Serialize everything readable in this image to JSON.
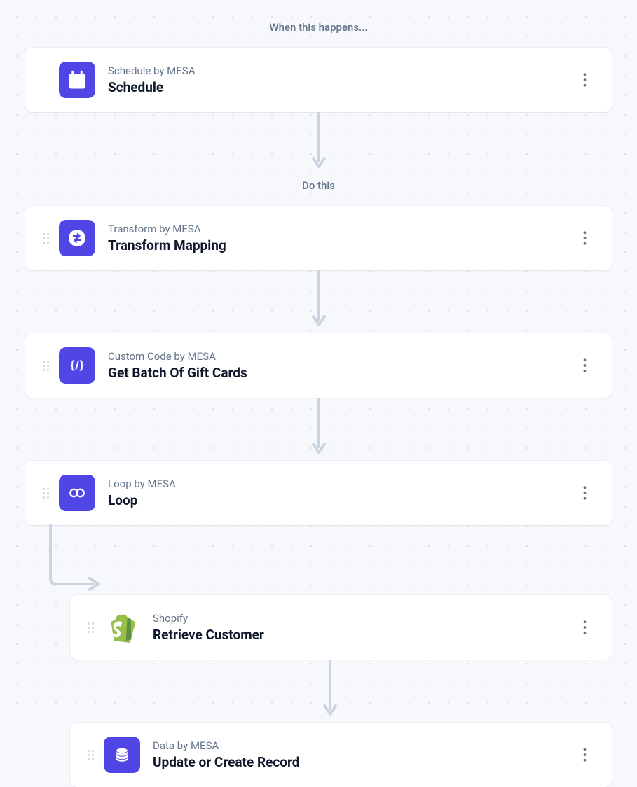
{
  "sections": {
    "trigger_label": "When this happens...",
    "action_label": "Do this"
  },
  "steps": [
    {
      "subtitle": "Schedule by MESA",
      "title": "Schedule"
    },
    {
      "subtitle": "Transform by MESA",
      "title": "Transform Mapping"
    },
    {
      "subtitle": "Custom Code by MESA",
      "title": "Get Batch Of Gift Cards"
    },
    {
      "subtitle": "Loop by MESA",
      "title": "Loop"
    },
    {
      "subtitle": "Shopify",
      "title": "Retrieve Customer"
    },
    {
      "subtitle": "Data by MESA",
      "title": "Update or Create Record"
    }
  ],
  "colors": {
    "mesa_blue": "#4f46e5",
    "shopify_green": "#95bf47"
  }
}
